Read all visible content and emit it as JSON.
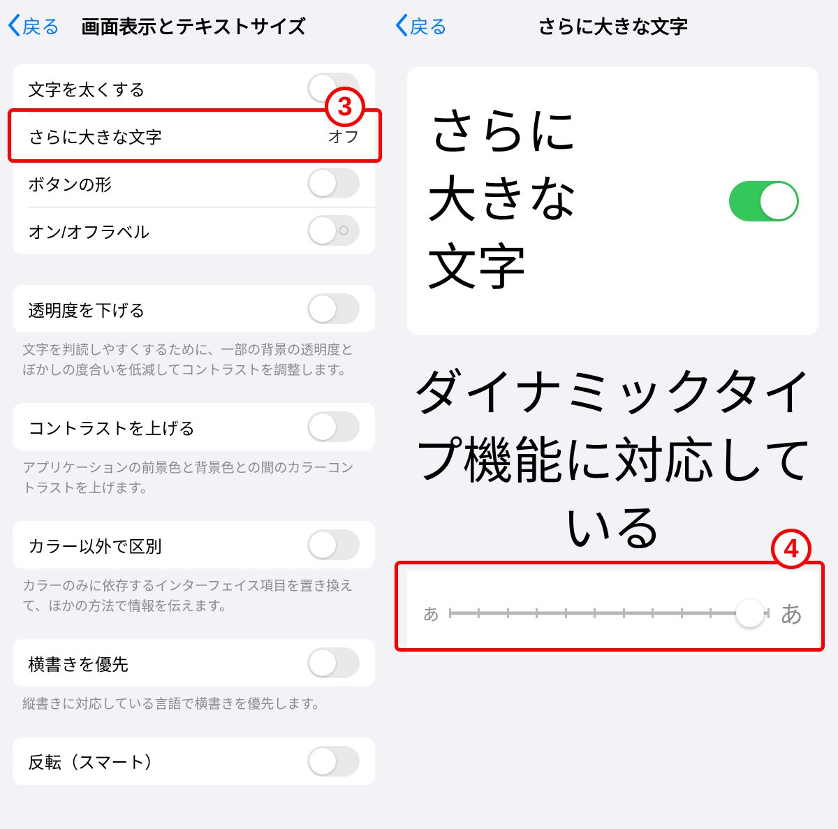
{
  "left": {
    "back": "戻る",
    "title": "画面表示とテキストサイズ",
    "group1": {
      "bold": "文字を太くする",
      "larger": "さらに大きな文字",
      "larger_value": "オフ",
      "button_shape": "ボタンの形",
      "on_off_label": "オン/オフラベル"
    },
    "reduce_trans": "透明度を下げる",
    "reduce_trans_desc": "文字を判読しやすくするために、一部の背景の透明度とぼかしの度合いを低減してコントラストを調整します。",
    "increase_contrast": "コントラストを上げる",
    "increase_contrast_desc": "アプリケーションの前景色と背景色との間のカラーコントラストを上げます。",
    "diff_no_color": "カラー以外で区別",
    "diff_no_color_desc": "カラーのみに依存するインターフェイス項目を置き換えて、ほかの方法で情報を伝えます。",
    "prefer_horiz": "横書きを優先",
    "prefer_horiz_desc": "縦書きに対応している言語で横書きを優先します。",
    "smart_invert": "反転（スマート）"
  },
  "right": {
    "back": "戻る",
    "title": "さらに大きな文字",
    "big_label": "さらに\n大きな\n文字",
    "dynamic_desc": "ダイナミックタイプ機能に対応している",
    "slider_small": "あ",
    "slider_large": "あ"
  },
  "badges": {
    "three": "3",
    "four": "4"
  }
}
